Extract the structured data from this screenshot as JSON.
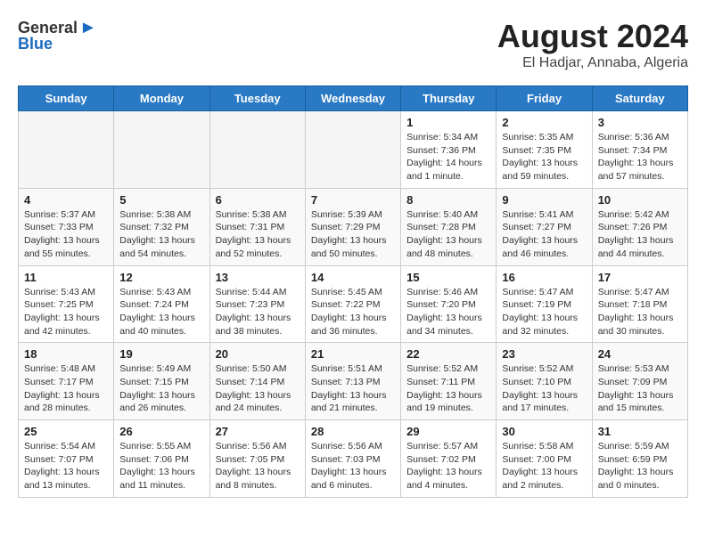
{
  "header": {
    "logo_general": "General",
    "logo_blue": "Blue",
    "title": "August 2024",
    "subtitle": "El Hadjar, Annaba, Algeria"
  },
  "weekdays": [
    "Sunday",
    "Monday",
    "Tuesday",
    "Wednesday",
    "Thursday",
    "Friday",
    "Saturday"
  ],
  "weeks": [
    [
      {
        "day": "",
        "info": ""
      },
      {
        "day": "",
        "info": ""
      },
      {
        "day": "",
        "info": ""
      },
      {
        "day": "",
        "info": ""
      },
      {
        "day": "1",
        "info": "Sunrise: 5:34 AM\nSunset: 7:36 PM\nDaylight: 14 hours\nand 1 minute."
      },
      {
        "day": "2",
        "info": "Sunrise: 5:35 AM\nSunset: 7:35 PM\nDaylight: 13 hours\nand 59 minutes."
      },
      {
        "day": "3",
        "info": "Sunrise: 5:36 AM\nSunset: 7:34 PM\nDaylight: 13 hours\nand 57 minutes."
      }
    ],
    [
      {
        "day": "4",
        "info": "Sunrise: 5:37 AM\nSunset: 7:33 PM\nDaylight: 13 hours\nand 55 minutes."
      },
      {
        "day": "5",
        "info": "Sunrise: 5:38 AM\nSunset: 7:32 PM\nDaylight: 13 hours\nand 54 minutes."
      },
      {
        "day": "6",
        "info": "Sunrise: 5:38 AM\nSunset: 7:31 PM\nDaylight: 13 hours\nand 52 minutes."
      },
      {
        "day": "7",
        "info": "Sunrise: 5:39 AM\nSunset: 7:29 PM\nDaylight: 13 hours\nand 50 minutes."
      },
      {
        "day": "8",
        "info": "Sunrise: 5:40 AM\nSunset: 7:28 PM\nDaylight: 13 hours\nand 48 minutes."
      },
      {
        "day": "9",
        "info": "Sunrise: 5:41 AM\nSunset: 7:27 PM\nDaylight: 13 hours\nand 46 minutes."
      },
      {
        "day": "10",
        "info": "Sunrise: 5:42 AM\nSunset: 7:26 PM\nDaylight: 13 hours\nand 44 minutes."
      }
    ],
    [
      {
        "day": "11",
        "info": "Sunrise: 5:43 AM\nSunset: 7:25 PM\nDaylight: 13 hours\nand 42 minutes."
      },
      {
        "day": "12",
        "info": "Sunrise: 5:43 AM\nSunset: 7:24 PM\nDaylight: 13 hours\nand 40 minutes."
      },
      {
        "day": "13",
        "info": "Sunrise: 5:44 AM\nSunset: 7:23 PM\nDaylight: 13 hours\nand 38 minutes."
      },
      {
        "day": "14",
        "info": "Sunrise: 5:45 AM\nSunset: 7:22 PM\nDaylight: 13 hours\nand 36 minutes."
      },
      {
        "day": "15",
        "info": "Sunrise: 5:46 AM\nSunset: 7:20 PM\nDaylight: 13 hours\nand 34 minutes."
      },
      {
        "day": "16",
        "info": "Sunrise: 5:47 AM\nSunset: 7:19 PM\nDaylight: 13 hours\nand 32 minutes."
      },
      {
        "day": "17",
        "info": "Sunrise: 5:47 AM\nSunset: 7:18 PM\nDaylight: 13 hours\nand 30 minutes."
      }
    ],
    [
      {
        "day": "18",
        "info": "Sunrise: 5:48 AM\nSunset: 7:17 PM\nDaylight: 13 hours\nand 28 minutes."
      },
      {
        "day": "19",
        "info": "Sunrise: 5:49 AM\nSunset: 7:15 PM\nDaylight: 13 hours\nand 26 minutes."
      },
      {
        "day": "20",
        "info": "Sunrise: 5:50 AM\nSunset: 7:14 PM\nDaylight: 13 hours\nand 24 minutes."
      },
      {
        "day": "21",
        "info": "Sunrise: 5:51 AM\nSunset: 7:13 PM\nDaylight: 13 hours\nand 21 minutes."
      },
      {
        "day": "22",
        "info": "Sunrise: 5:52 AM\nSunset: 7:11 PM\nDaylight: 13 hours\nand 19 minutes."
      },
      {
        "day": "23",
        "info": "Sunrise: 5:52 AM\nSunset: 7:10 PM\nDaylight: 13 hours\nand 17 minutes."
      },
      {
        "day": "24",
        "info": "Sunrise: 5:53 AM\nSunset: 7:09 PM\nDaylight: 13 hours\nand 15 minutes."
      }
    ],
    [
      {
        "day": "25",
        "info": "Sunrise: 5:54 AM\nSunset: 7:07 PM\nDaylight: 13 hours\nand 13 minutes."
      },
      {
        "day": "26",
        "info": "Sunrise: 5:55 AM\nSunset: 7:06 PM\nDaylight: 13 hours\nand 11 minutes."
      },
      {
        "day": "27",
        "info": "Sunrise: 5:56 AM\nSunset: 7:05 PM\nDaylight: 13 hours\nand 8 minutes."
      },
      {
        "day": "28",
        "info": "Sunrise: 5:56 AM\nSunset: 7:03 PM\nDaylight: 13 hours\nand 6 minutes."
      },
      {
        "day": "29",
        "info": "Sunrise: 5:57 AM\nSunset: 7:02 PM\nDaylight: 13 hours\nand 4 minutes."
      },
      {
        "day": "30",
        "info": "Sunrise: 5:58 AM\nSunset: 7:00 PM\nDaylight: 13 hours\nand 2 minutes."
      },
      {
        "day": "31",
        "info": "Sunrise: 5:59 AM\nSunset: 6:59 PM\nDaylight: 13 hours\nand 0 minutes."
      }
    ]
  ]
}
